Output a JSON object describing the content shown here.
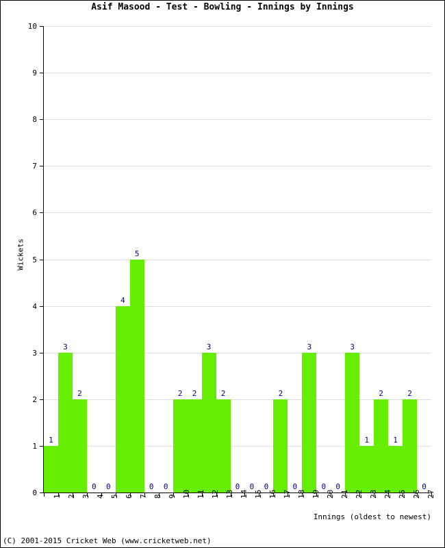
{
  "title": "Asif Masood - Test - Bowling - Innings by Innings",
  "footer": "(C) 2001-2015 Cricket Web (www.cricketweb.net)",
  "colors": {
    "bar": "#66ee00",
    "value_label": "#000080",
    "gridline": "#dddddd",
    "axis": "#000000",
    "background": "#ffffff"
  },
  "chart_data": {
    "type": "bar",
    "title": "Asif Masood - Test - Bowling - Innings by Innings",
    "xlabel": "Innings (oldest to newest)",
    "ylabel": "Wickets",
    "categories": [
      "1",
      "2",
      "3",
      "4",
      "5",
      "6",
      "7",
      "8",
      "9",
      "10",
      "11",
      "12",
      "13",
      "14",
      "15",
      "16",
      "17",
      "18",
      "19",
      "20",
      "21",
      "22",
      "23",
      "24",
      "25",
      "26",
      "27"
    ],
    "values": [
      1,
      3,
      2,
      0,
      0,
      4,
      5,
      0,
      0,
      2,
      2,
      3,
      2,
      0,
      0,
      0,
      2,
      0,
      3,
      0,
      0,
      3,
      1,
      2,
      1,
      2,
      0
    ],
    "ylim": [
      0,
      10
    ],
    "yticks": [
      0,
      1,
      2,
      3,
      4,
      5,
      6,
      7,
      8,
      9,
      10
    ],
    "ytick_labels": [
      "0",
      "1",
      "2",
      "3",
      "4",
      "5",
      "6",
      "7",
      "8",
      "9",
      "10"
    ],
    "grid": true,
    "legend": false,
    "data_labels": true,
    "series_color": "#66ee00"
  }
}
